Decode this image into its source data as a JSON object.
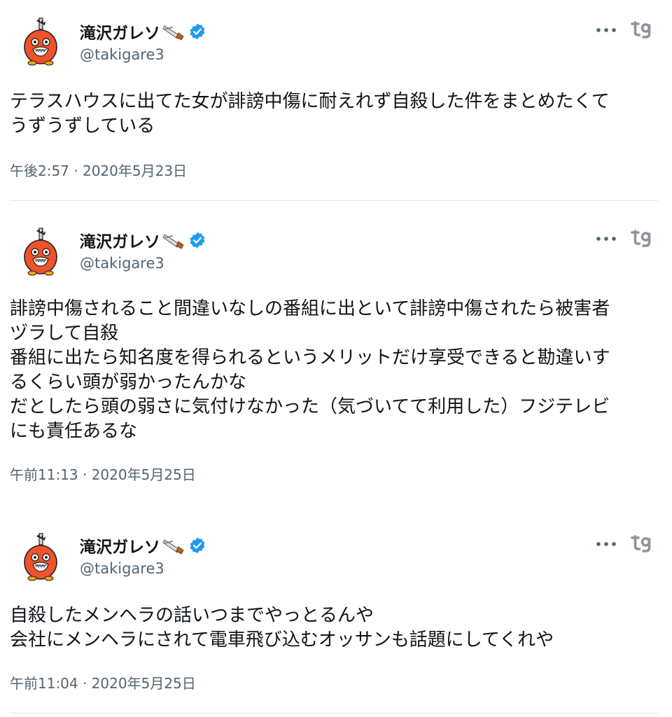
{
  "tweets": [
    {
      "author_name": "滝沢ガレソ",
      "handle": "@takigare3",
      "text": "テラスハウスに出てた女が誹謗中傷に耐えれず自殺した件をまとめたくて\nうずうずしている",
      "timestamp": "午後2:57 · 2020年5月23日"
    },
    {
      "author_name": "滝沢ガレソ",
      "handle": "@takigare3",
      "text": "誹謗中傷されること間違いなしの番組に出といて誹謗中傷されたら被害者\nヅラして自殺\n番組に出たら知名度を得られるというメリットだけ享受できると勘違いす\nるくらい頭が弱かったんかな\nだとしたら頭の弱さに気付けなかった（気づいてて利用した）フジテレビ\nにも責任あるな",
      "timestamp": "午前11:13 · 2020年5月25日"
    },
    {
      "author_name": "滝沢ガレソ",
      "handle": "@takigare3",
      "text": "自殺したメンヘラの話いつまでやっとるんや\n会社にメンヘラにされて電車飛び込むオッサンも話題にしてくれや",
      "timestamp": "午前11:04 · 2020年5月25日"
    }
  ],
  "icons": {
    "name_emoji": "saw-icon",
    "verified": "verified-badge-icon",
    "more": "more-options-icon",
    "logo": "tg-logo-icon",
    "avatar": "orange-chainsaw-bird-avatar"
  },
  "colors": {
    "verified": "#1d9bf0",
    "secondary_text": "#536471",
    "primary_text": "#0f1419",
    "avatar_orange": "#f0522a",
    "divider": "#e3e7ea"
  }
}
